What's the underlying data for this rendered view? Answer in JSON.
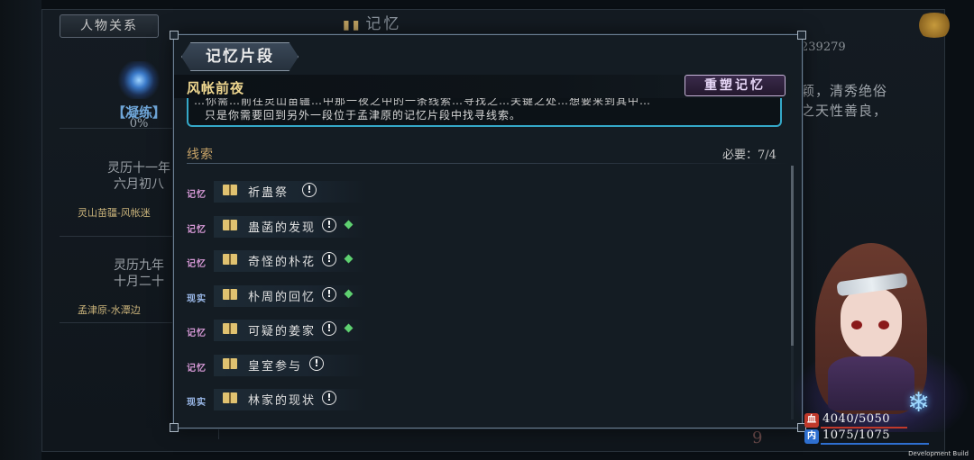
{
  "background": {
    "relations_tab": "人物关系",
    "memory_header": "记忆",
    "status_tag": "【凝练】",
    "status_pct": "0%",
    "dates": [
      {
        "line1": "灵历十一年",
        "line2": "六月初八",
        "location": "灵山苗疆-风帐迷"
      },
      {
        "line1": "灵历九年",
        "line2": "十月二十",
        "location": "孟津原-水潭边"
      }
    ],
    "right_number": "239279",
    "right_text_line1": "颖，清秀绝俗",
    "right_text_line2": "之天性善良，",
    "page_number": "9"
  },
  "modal": {
    "title": "记忆片段",
    "fragment_title": "风帐前夜",
    "reshape_button": "重塑记忆",
    "description_line1": "…你需…前往灵山苗疆…中那一夜之中的一条线索…寻找之…关键之处…想要来到其中…",
    "description_line2": "只是你需要回到另外一段位于孟津原的记忆片段中找寻线索。",
    "clue_header": "线索",
    "required_label": "必要：7/4",
    "clues": [
      {
        "tag": "记忆",
        "type": "memory",
        "name": "祈蛊祭",
        "alert": "!",
        "found": false
      },
      {
        "tag": "记忆",
        "type": "memory",
        "name": "蛊菡的发现",
        "alert": "!",
        "found": true
      },
      {
        "tag": "记忆",
        "type": "memory",
        "name": "奇怪的朴花",
        "alert": "!",
        "found": true
      },
      {
        "tag": "现实",
        "type": "reality",
        "name": "朴周的回忆",
        "alert": "!",
        "found": true
      },
      {
        "tag": "记忆",
        "type": "memory",
        "name": "可疑的姜家",
        "alert": "!",
        "found": true
      },
      {
        "tag": "记忆",
        "type": "memory",
        "name": "皇室参与",
        "alert": "!",
        "found": false
      },
      {
        "tag": "现实",
        "type": "reality",
        "name": "林家的现状",
        "alert": "!",
        "found": false
      }
    ]
  },
  "character": {
    "hp_icon": "血",
    "hp": "4040/5050",
    "hp_fraction": 0.8,
    "mp_icon": "内",
    "mp": "1075/1075",
    "mp_fraction": 1.0,
    "hp_color": "#c0392b",
    "mp_color": "#2e6fd0",
    "snowflake_icon": "❄"
  },
  "footer": {
    "dev_build": "Development Build"
  },
  "colors": {
    "accent_gold": "#f0d890",
    "accent_cyan": "#35a8c8",
    "found_green": "#5ed070",
    "memory_tag": "#d89ad8",
    "reality_tag": "#9ab8e8"
  }
}
